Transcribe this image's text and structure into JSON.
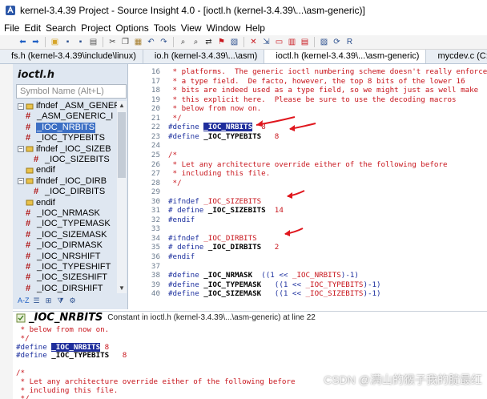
{
  "window": {
    "title": "kernel-3.4.39 Project - Source Insight 4.0 - [ioctl.h (kernel-3.4.39\\...\\asm-generic)]"
  },
  "menu": [
    "File",
    "Edit",
    "Search",
    "Project",
    "Options",
    "Tools",
    "View",
    "Window",
    "Help"
  ],
  "toolbar": {
    "icons": [
      "back-icon",
      "forward-icon",
      "open-folder-icon",
      "save-icon",
      "save-all-icon",
      "print-icon",
      "cut-icon",
      "copy-icon",
      "paste-icon",
      "undo-icon",
      "redo-icon",
      "find-icon",
      "find-next-icon",
      "replace-icon",
      "bookmark-icon",
      "browse-icon",
      "symbol-icon",
      "jump-icon",
      "window-icon",
      "tile-icon",
      "cascade-icon",
      "relation-icon",
      "sync-icon",
      "reload-icon"
    ]
  },
  "tabs": [
    {
      "label": "fs.h (kernel-3.4.39\\include\\linux)",
      "active": false
    },
    {
      "label": "io.h (kernel-3.4.39\\...\\asm)",
      "active": false
    },
    {
      "label": "ioctl.h (kernel-3.4.39\\...\\asm-generic)",
      "active": true
    },
    {
      "label": "mycdev.c (C:\\U",
      "active": false
    }
  ],
  "symbol_panel": {
    "title": "ioctl.h",
    "search_placeholder": "Symbol Name (Alt+L)",
    "items": [
      {
        "label": "ifndef _ASM_GENER",
        "kind": "ifdef",
        "level": 0,
        "expander": "-"
      },
      {
        "label": "_ASM_GENERIC_I",
        "kind": "macro",
        "level": 1
      },
      {
        "label": "_IOC_NRBITS",
        "kind": "macro",
        "level": 1,
        "selected": true
      },
      {
        "label": "_IOC_TYPEBITS",
        "kind": "macro",
        "level": 1
      },
      {
        "label": "ifndef _IOC_SIZEB",
        "kind": "ifdef",
        "level": 0,
        "expander": "-"
      },
      {
        "label": "_IOC_SIZEBITS",
        "kind": "macro",
        "level": 2
      },
      {
        "label": "endif",
        "kind": "ifdef",
        "level": 1
      },
      {
        "label": "ifndef _IOC_DIRB",
        "kind": "ifdef",
        "level": 0,
        "expander": "-"
      },
      {
        "label": "_IOC_DIRBITS",
        "kind": "macro",
        "level": 2
      },
      {
        "label": "endif",
        "kind": "ifdef",
        "level": 1
      },
      {
        "label": "_IOC_NRMASK",
        "kind": "macro",
        "level": 1
      },
      {
        "label": "_IOC_TYPEMASK",
        "kind": "macro",
        "level": 1
      },
      {
        "label": "_IOC_SIZEMASK",
        "kind": "macro",
        "level": 1
      },
      {
        "label": "_IOC_DIRMASK",
        "kind": "macro",
        "level": 1
      },
      {
        "label": "_IOC_NRSHIFT",
        "kind": "macro",
        "level": 1
      },
      {
        "label": "_IOC_TYPESHIFT",
        "kind": "macro",
        "level": 1
      },
      {
        "label": "_IOC_SIZESHIFT",
        "kind": "macro",
        "level": 1
      },
      {
        "label": "_IOC_DIRSHIFT",
        "kind": "macro",
        "level": 1
      }
    ],
    "tools": [
      "A-Z",
      "list-icon",
      "tree-icon",
      "filter-icon",
      "settings-icon"
    ]
  },
  "editor": {
    "lines": [
      {
        "n": "16",
        "segs": [
          {
            "t": " * platforms.  The generic ioctl numbering scheme doesn't really enforce",
            "c": "cm"
          }
        ]
      },
      {
        "n": "17",
        "segs": [
          {
            "t": " * a type field.  De facto, however, the top 8 bits of the lower 16",
            "c": "cm"
          }
        ]
      },
      {
        "n": "18",
        "segs": [
          {
            "t": " * bits are indeed used as a type field, so we might just as well make",
            "c": "cm"
          }
        ]
      },
      {
        "n": "19",
        "segs": [
          {
            "t": " * this explicit here.  Please be sure to use the decoding macros",
            "c": "cm"
          }
        ]
      },
      {
        "n": "20",
        "segs": [
          {
            "t": " * below from now on.",
            "c": "cm"
          }
        ]
      },
      {
        "n": "21",
        "segs": [
          {
            "t": " */",
            "c": "cm"
          }
        ]
      },
      {
        "n": "22",
        "segs": [
          {
            "t": "#define ",
            "c": "kw"
          },
          {
            "t": "_IOC_NRBITS",
            "c": "sym-hl"
          },
          {
            "t": "  8",
            "c": "num"
          }
        ]
      },
      {
        "n": "23",
        "segs": [
          {
            "t": "#define ",
            "c": "kw"
          },
          {
            "t": "_IOC_TYPEBITS",
            "c": "sym"
          },
          {
            "t": "   8",
            "c": "num"
          }
        ]
      },
      {
        "n": "24",
        "segs": [
          {
            "t": "",
            "c": ""
          }
        ]
      },
      {
        "n": "25",
        "segs": [
          {
            "t": "/*",
            "c": "cm"
          }
        ]
      },
      {
        "n": "26",
        "segs": [
          {
            "t": " * Let any architecture override either of the following before",
            "c": "cm"
          }
        ]
      },
      {
        "n": "27",
        "segs": [
          {
            "t": " * including this file.",
            "c": "cm"
          }
        ]
      },
      {
        "n": "28",
        "segs": [
          {
            "t": " */",
            "c": "cm"
          }
        ]
      },
      {
        "n": "29",
        "segs": [
          {
            "t": "",
            "c": ""
          }
        ]
      },
      {
        "n": "30",
        "segs": [
          {
            "t": "#ifndef ",
            "c": "kw"
          },
          {
            "t": "_IOC_SIZEBITS",
            "c": "mac"
          }
        ]
      },
      {
        "n": "31",
        "segs": [
          {
            "t": "# define ",
            "c": "kw"
          },
          {
            "t": "_IOC_SIZEBITS",
            "c": "sym"
          },
          {
            "t": "  14",
            "c": "num"
          }
        ]
      },
      {
        "n": "32",
        "segs": [
          {
            "t": "#endif",
            "c": "kw"
          }
        ]
      },
      {
        "n": "33",
        "segs": [
          {
            "t": "",
            "c": ""
          }
        ]
      },
      {
        "n": "34",
        "segs": [
          {
            "t": "#ifndef ",
            "c": "kw"
          },
          {
            "t": "_IOC_DIRBITS",
            "c": "mac"
          }
        ]
      },
      {
        "n": "35",
        "segs": [
          {
            "t": "# define ",
            "c": "kw"
          },
          {
            "t": "_IOC_DIRBITS",
            "c": "sym"
          },
          {
            "t": "   2",
            "c": "num"
          }
        ]
      },
      {
        "n": "36",
        "segs": [
          {
            "t": "#endif",
            "c": "kw"
          }
        ]
      },
      {
        "n": "37",
        "segs": [
          {
            "t": "",
            "c": ""
          }
        ]
      },
      {
        "n": "38",
        "segs": [
          {
            "t": "#define ",
            "c": "kw"
          },
          {
            "t": "_IOC_NRMASK",
            "c": "sym"
          },
          {
            "t": "  ((1 << ",
            "c": "kw"
          },
          {
            "t": "_IOC_NRBITS",
            "c": "mac"
          },
          {
            "t": ")-1)",
            "c": "kw"
          }
        ]
      },
      {
        "n": "39",
        "segs": [
          {
            "t": "#define ",
            "c": "kw"
          },
          {
            "t": "_IOC_TYPEMASK",
            "c": "sym"
          },
          {
            "t": "   ((1 << ",
            "c": "kw"
          },
          {
            "t": "_IOC_TYPEBITS",
            "c": "mac"
          },
          {
            "t": ")-1)",
            "c": "kw"
          }
        ]
      },
      {
        "n": "40",
        "segs": [
          {
            "t": "#define ",
            "c": "kw"
          },
          {
            "t": "_IOC_SIZEMASK",
            "c": "sym"
          },
          {
            "t": "   ((1 << ",
            "c": "kw"
          },
          {
            "t": "_IOC_SIZEBITS",
            "c": "mac"
          },
          {
            "t": ")-1)",
            "c": "kw"
          }
        ]
      }
    ]
  },
  "context": {
    "symbol": "_IOC_NRBITS",
    "info": "Constant in ioctl.h (kernel-3.4.39\\...\\asm-generic) at line 22",
    "lines": [
      [
        {
          "t": " * below from now on.",
          "c": "cm"
        }
      ],
      [
        {
          "t": " */",
          "c": "cm"
        }
      ],
      [
        {
          "t": "#define ",
          "c": "kw"
        },
        {
          "t": "_IOC_NRBITS",
          "c": "sym-hl"
        },
        {
          "t": " 8",
          "c": "num"
        }
      ],
      [
        {
          "t": "#define ",
          "c": "kw"
        },
        {
          "t": "_IOC_TYPEBITS",
          "c": "sym"
        },
        {
          "t": "   8",
          "c": "num"
        }
      ],
      [
        {
          "t": "",
          "c": ""
        }
      ],
      [
        {
          "t": "/*",
          "c": "cm"
        }
      ],
      [
        {
          "t": " * Let any architecture override either of the following before",
          "c": "cm"
        }
      ],
      [
        {
          "t": " * including this file.",
          "c": "cm"
        }
      ],
      [
        {
          "t": " */",
          "c": "cm"
        }
      ]
    ]
  },
  "watermark": "CSDN @满山的猴子我的腚最红",
  "colors": {
    "comment": "#c8161d",
    "keyword": "#1c2f9e",
    "selection": "#1f2e9c",
    "annotation_arrow": "#e0161d"
  }
}
